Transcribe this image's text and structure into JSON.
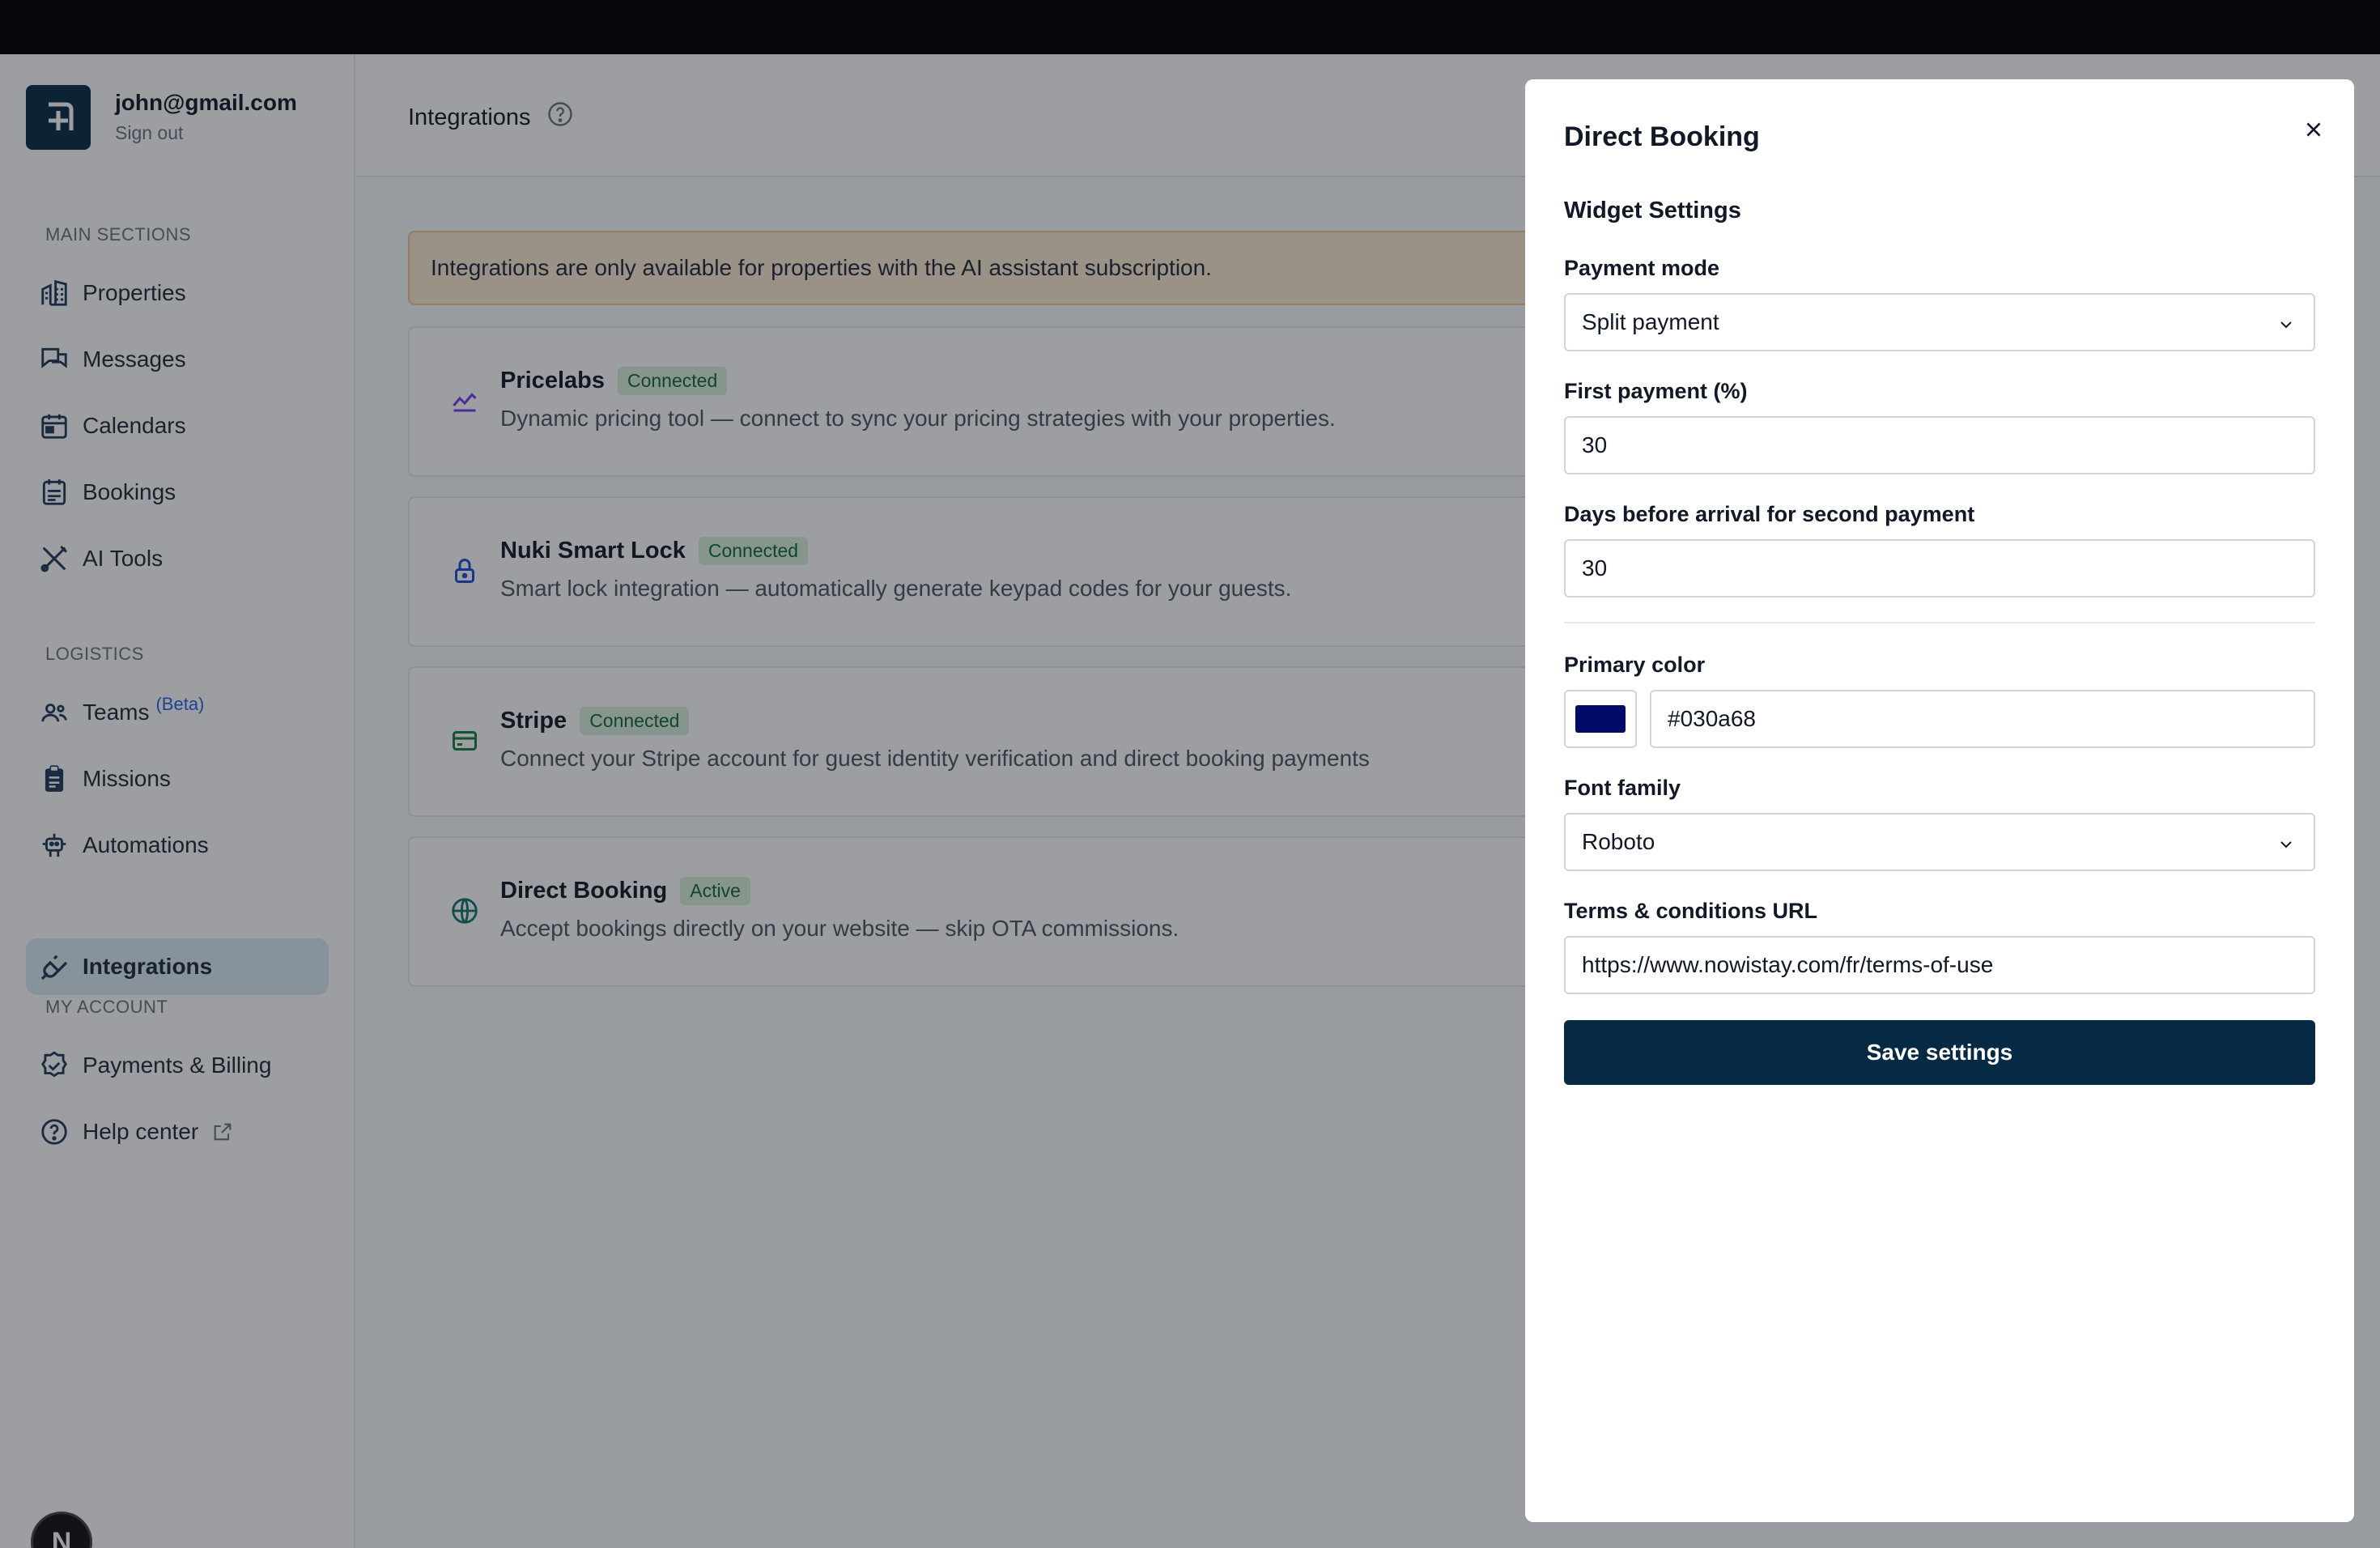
{
  "user": {
    "email": "john@gmail.com",
    "sign_out": "Sign out"
  },
  "sidebar": {
    "main_label": "MAIN SECTIONS",
    "main_items": [
      {
        "label": "Properties",
        "icon": "building-icon"
      },
      {
        "label": "Messages",
        "icon": "chat-icon"
      },
      {
        "label": "Calendars",
        "icon": "calendar-icon"
      },
      {
        "label": "Bookings",
        "icon": "list-icon"
      },
      {
        "label": "AI Tools",
        "icon": "tools-icon"
      }
    ],
    "logistics_label": "LOGISTICS",
    "logistics_items": [
      {
        "label": "Teams",
        "beta": "(Beta)",
        "icon": "users-icon"
      },
      {
        "label": "Missions",
        "icon": "clipboard-icon"
      },
      {
        "label": "Automations",
        "icon": "robot-icon"
      },
      {
        "label": "Integrations",
        "icon": "plug-icon",
        "active": true
      }
    ],
    "account_label": "MY ACCOUNT",
    "account_items": [
      {
        "label": "Payments & Billing",
        "icon": "badge-check-icon"
      },
      {
        "label": "Help center",
        "icon": "help-circle-icon"
      }
    ],
    "n_badge": "N"
  },
  "main": {
    "title": "Integrations",
    "alert": "Integrations are only available for properties with the AI assistant subscription.",
    "cards": [
      {
        "name": "Pricelabs",
        "badge": "Connected",
        "desc": "Dynamic pricing tool — connect to sync your pricing strategies with your properties.",
        "icon": "chart-line-icon"
      },
      {
        "name": "Nuki Smart Lock",
        "badge": "Connected",
        "desc": "Smart lock integration — automatically generate keypad codes for your guests.",
        "icon": "lock-icon"
      },
      {
        "name": "Stripe",
        "badge": "Connected",
        "desc": "Connect your Stripe account for guest identity verification and direct booking payments",
        "icon": "card-icon"
      },
      {
        "name": "Direct Booking",
        "badge": "Active",
        "desc": "Accept bookings directly on your website — skip OTA commissions.",
        "icon": "globe-icon"
      }
    ]
  },
  "panel": {
    "title": "Direct Booking",
    "subtitle": "Widget Settings",
    "payment_mode_label": "Payment mode",
    "payment_mode_value": "Split payment",
    "first_payment_label": "First payment (%)",
    "first_payment_value": "30",
    "days_label": "Days before arrival for second payment",
    "days_value": "30",
    "primary_color_label": "Primary color",
    "primary_color_value": "#030a68",
    "font_family_label": "Font family",
    "font_family_value": "Roboto",
    "terms_label": "Terms & conditions URL",
    "terms_value": "https://www.nowistay.com/fr/terms-of-use",
    "save_label": "Save settings"
  },
  "colors": {
    "accent": "#062a44",
    "swatch": "#030a68",
    "badge_bg": "#d9f2dd",
    "alert_bg": "#fdebd3"
  }
}
